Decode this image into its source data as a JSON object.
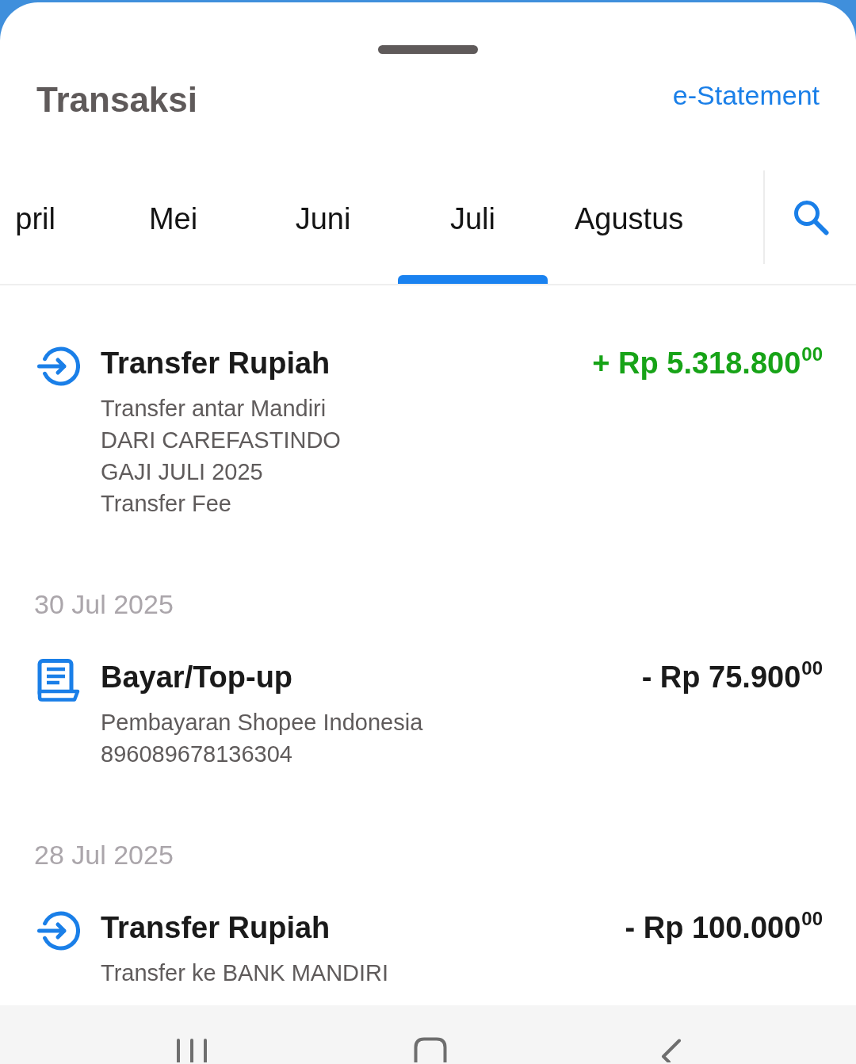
{
  "sheet": {
    "title": "Transaksi",
    "link": "e-Statement"
  },
  "tabs": [
    {
      "label": "pril",
      "selected": false
    },
    {
      "label": "Mei",
      "selected": false
    },
    {
      "label": "Juni",
      "selected": false
    },
    {
      "label": "Juli",
      "selected": true
    },
    {
      "label": "Agustus",
      "selected": false
    }
  ],
  "groups": [
    {
      "transactions": [
        {
          "kind": "transfer",
          "credit": true,
          "title": "Transfer Rupiah",
          "amount": "+ Rp 5.318.800$^{00}$",
          "details": [
            "Transfer antar Mandiri",
            "DARI CAREFASTINDO",
            "GAJI JULI 2025",
            "Transfer Fee"
          ]
        }
      ]
    },
    {
      "date": "30 Jul 2025",
      "transactions": [
        {
          "kind": "payment",
          "credit": false,
          "title": "Bayar/Top-up",
          "amount": "- Rp 75.900$^{00}$",
          "details": [
            "Pembayaran Shopee Indonesia",
            "896089678136304"
          ]
        }
      ]
    },
    {
      "date": "28 Jul 2025",
      "transactions": [
        {
          "kind": "transfer",
          "credit": false,
          "title": "Transfer Rupiah",
          "amount": "- Rp 100.000$^{00}$",
          "details": [
            "Transfer ke BANK MANDIRI"
          ]
        }
      ]
    }
  ]
}
